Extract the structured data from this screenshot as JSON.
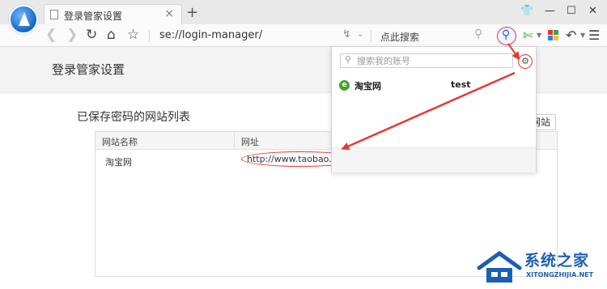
{
  "browser": {
    "tab_title": "登录管家设置",
    "tab_close": "×",
    "new_tab": "+",
    "url": "se://login-manager/",
    "search_placeholder": "点此搜索",
    "window_controls": [
      "minimize-icon",
      "maximize-icon",
      "close-icon"
    ]
  },
  "page": {
    "title": "登录管家设置",
    "section_title": "已保存密码的网站列表",
    "add_site_button": "网站",
    "table": {
      "columns": [
        "网站名称",
        "网址"
      ],
      "rows": [
        {
          "name": "淘宝网",
          "url": "http://www.taobao.com/"
        }
      ]
    }
  },
  "popup": {
    "search_placeholder": "搜索我的账号",
    "accounts": [
      {
        "site": "淘宝网",
        "username": "test"
      }
    ]
  },
  "watermark": {
    "text_cn": "系统之家",
    "text_en": "XITONGZHIJIA.NET"
  },
  "colors": {
    "annotation_red": "#e53935",
    "accent_blue": "#1e63d6",
    "brand_green": "#45a432"
  }
}
